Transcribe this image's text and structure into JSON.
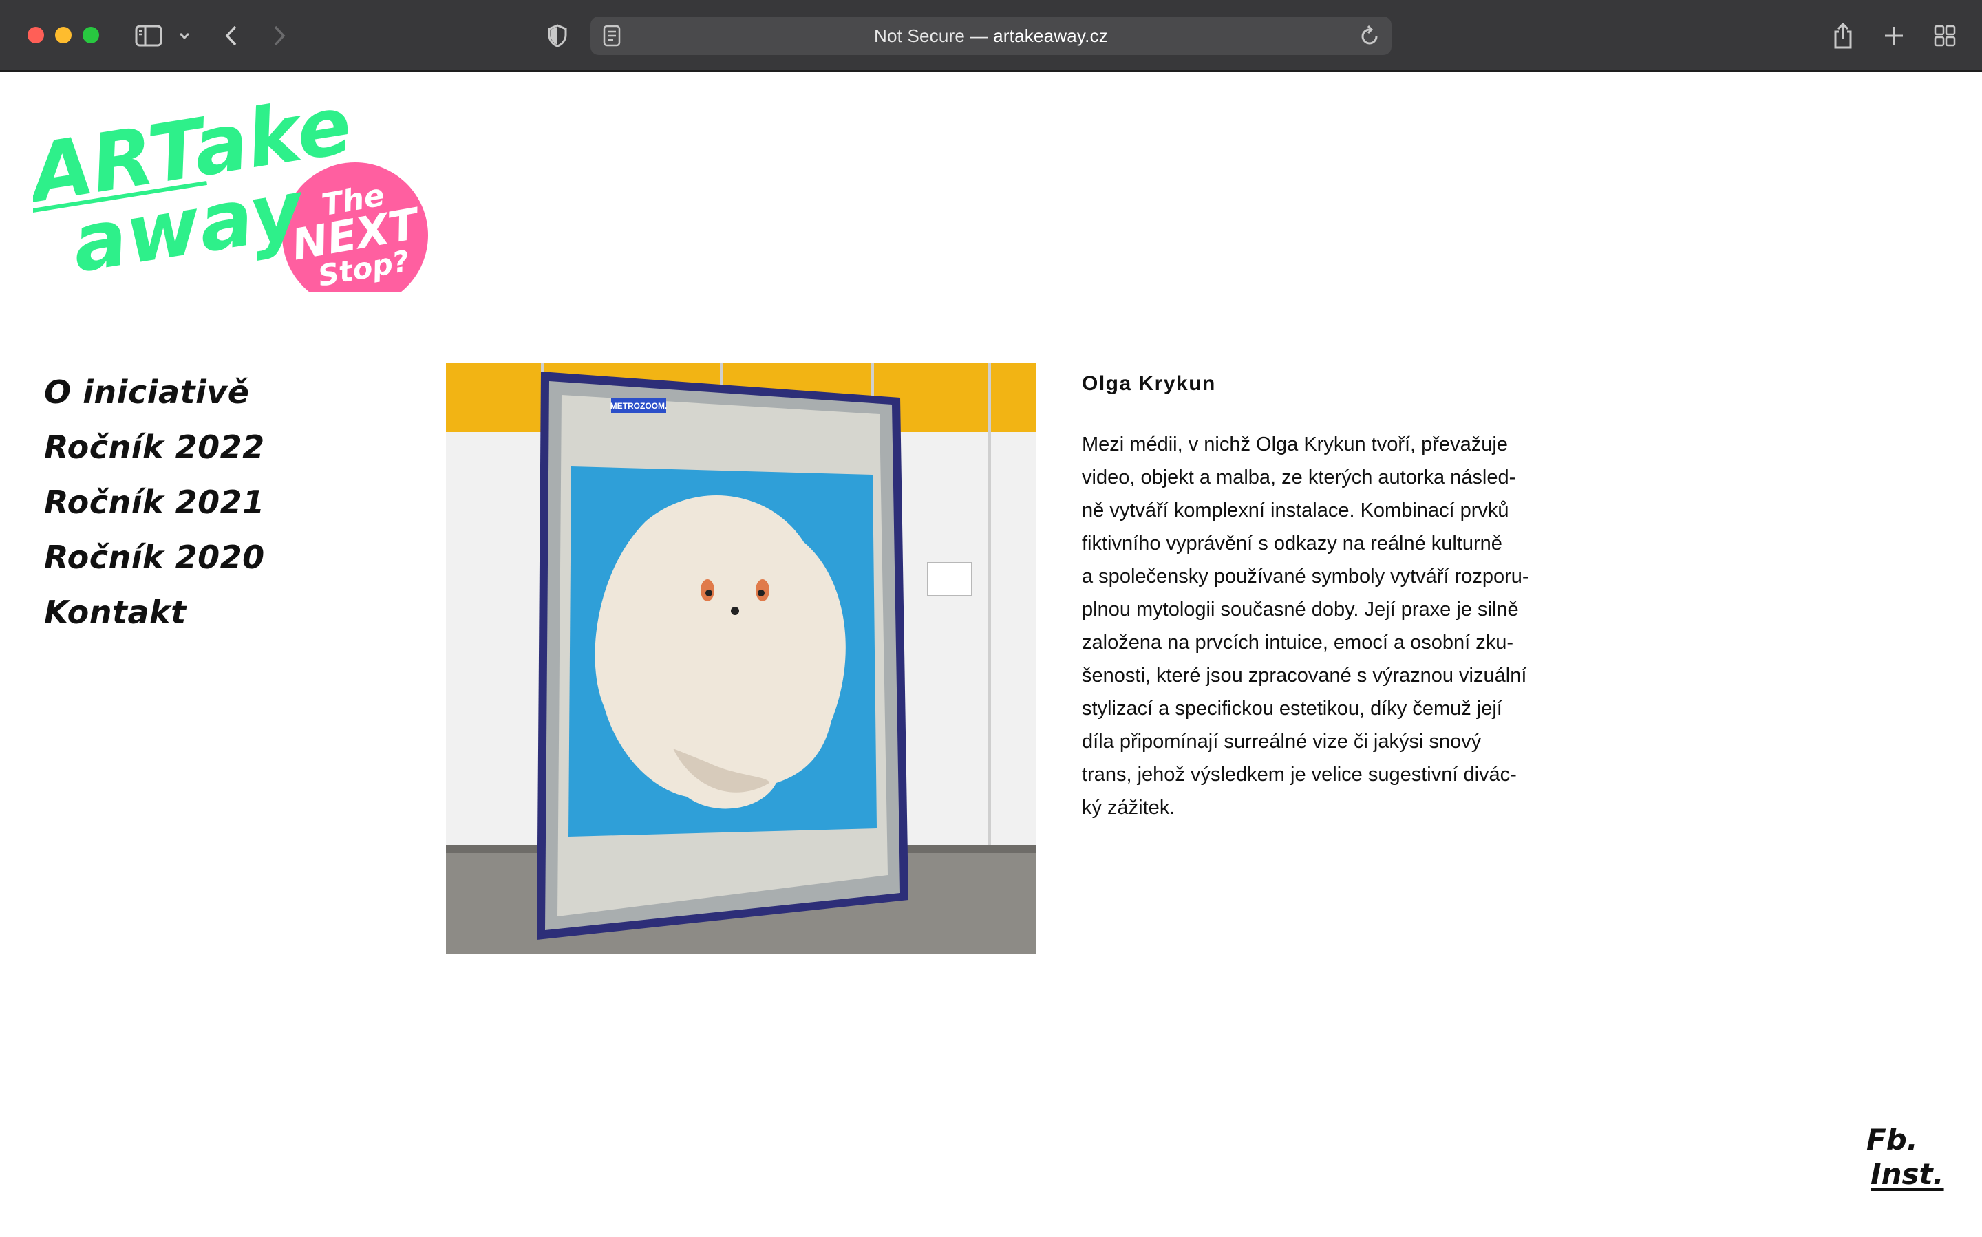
{
  "browser": {
    "url_prefix": "Not Secure — ",
    "url_host": "artakeaway.cz"
  },
  "logo": {
    "line1": "ARTake",
    "line2": "away",
    "badge_line1": "The",
    "badge_line2": "NEXT",
    "badge_line3": "Stop?",
    "colors": {
      "green": "#2ef08a",
      "pink": "#ff5fa0"
    }
  },
  "nav": {
    "items": [
      {
        "label": "O iniciativě"
      },
      {
        "label": "Ročník 2022"
      },
      {
        "label": "Ročník 2021"
      },
      {
        "label": "Ročník 2020"
      },
      {
        "label": "Kontakt"
      }
    ]
  },
  "artwork": {
    "poster_tag": "METROZOOM."
  },
  "article": {
    "artist": "Olga Krykun",
    "bio_lines": [
      "Mezi médii, v nichž Olga Krykun tvoří, převažuje",
      "video, objekt a malba, ze kterých autorka násled-",
      "ně vytváří komplexní instalace. Kombinací prvků",
      "fiktivního vyprávění s odkazy na reálné kulturně",
      "a společensky používané symboly vytváří rozporu-",
      "plnou mytologii současné doby. Její praxe je silně",
      "založena na prvcích intuice, emocí a osobní zku-",
      "šenosti, které jsou zpracované s výraznou vizuální",
      "stylizací a specifickou estetikou, díky čemuž její",
      "díla připomínají surreálné vize či jakýsi snový",
      "trans, jehož výsledkem je velice sugestivní divác-",
      "ký zážitek."
    ]
  },
  "social": {
    "fb_label": "Fb.",
    "inst_label": "Inst."
  }
}
